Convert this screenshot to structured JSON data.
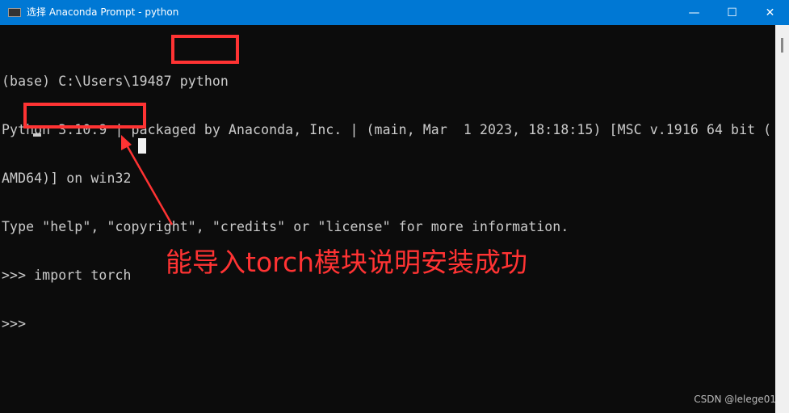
{
  "window": {
    "title": "选择 Anaconda Prompt - python",
    "icon": "terminal-icon",
    "controls": {
      "minimize": "—",
      "maximize": "☐",
      "close": "✕"
    }
  },
  "terminal": {
    "lines": [
      "(base) C:\\Users\\19487 python",
      "Python 3.10.9 | packaged by Anaconda, Inc. | (main, Mar  1 2023, 18:18:15) [MSC v.1916 64 bit (",
      "AMD64)] on win32",
      "Type \"help\", \"copyright\", \"credits\" or \"license\" for more information.",
      ">>> import torch",
      ">>> "
    ]
  },
  "annotation": {
    "text": "能导入torch模块说明安装成功",
    "color": "#ff3333"
  },
  "watermark": "CSDN @lelege01",
  "colors": {
    "titlebar": "#0078d4",
    "background": "#0c0c0c",
    "text": "#cccccc",
    "highlight": "#ff3333"
  }
}
